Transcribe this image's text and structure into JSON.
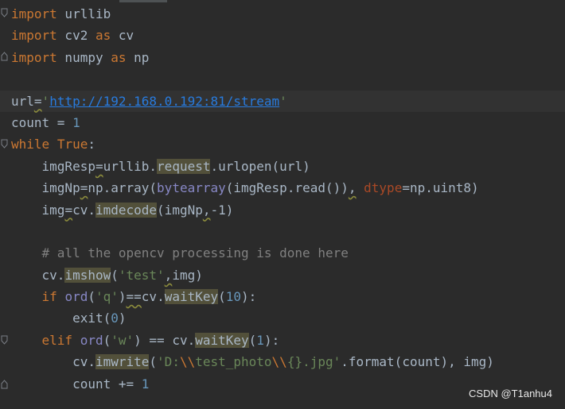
{
  "editor": {
    "lines": [
      {
        "tokens": [
          [
            "kw",
            "import"
          ],
          [
            "",
            "urllib"
          ]
        ]
      },
      {
        "tokens": [
          [
            "kw",
            "import"
          ],
          [
            "",
            "cv2"
          ],
          [
            "kw",
            "as"
          ],
          [
            "",
            "cv"
          ]
        ]
      },
      {
        "tokens": [
          [
            "kw",
            "import"
          ],
          [
            "",
            "numpy"
          ],
          [
            "kw",
            "as"
          ],
          [
            "",
            "np"
          ]
        ]
      },
      {
        "tokens": []
      },
      {
        "current": true,
        "tokens": [
          [
            "",
            "url"
          ],
          [
            "squig",
            "="
          ],
          [
            "str",
            "'"
          ],
          [
            "url",
            "http://192.168.0.192:81/stream"
          ],
          [
            "str",
            "'"
          ]
        ]
      },
      {
        "tokens": [
          [
            "",
            "count = "
          ],
          [
            "num",
            "1"
          ]
        ]
      },
      {
        "tokens": [
          [
            "kw",
            "while"
          ],
          [
            "",
            "SP"
          ],
          [
            "kw",
            "True"
          ],
          [
            "",
            ":"
          ]
        ]
      }
    ],
    "code": {
      "l1_kw": "import",
      "l1_mod": " urllib",
      "l2_kw": "import",
      "l2_mod": " cv2 ",
      "l2_as": "as",
      "l2_alias": " cv",
      "l3_kw": "import",
      "l3_mod": " numpy ",
      "l3_as": "as",
      "l3_alias": " np",
      "l5_a": "url",
      "l5_eq": "=",
      "l5_q1": "'",
      "l5_url": "http://192.168.0.192:81/stream",
      "l5_q2": "'",
      "l6_a": "count = ",
      "l6_num": "1",
      "l7_kw": "while",
      "l7_sp": " ",
      "l7_true": "True",
      "l7_colon": ":",
      "l8_a": "    imgResp",
      "l8_eq": "=",
      "l8_b": "urllib.",
      "l8_req": "request",
      "l8_c": ".urlopen(url)",
      "l9_a": "    imgNp",
      "l9_eq": "=",
      "l9_b": "np.array(",
      "l9_bi": "bytearray",
      "l9_c": "(imgResp.read())",
      "l9_comma": ",",
      "l9_sp": " ",
      "l9_param": "dtype",
      "l9_d": "=np.uint8)",
      "l10_a": "    img",
      "l10_eq": "=",
      "l10_b": "cv.",
      "l10_fn": "imdecode",
      "l10_c": "(imgNp",
      "l10_comma": ",",
      "l10_num": "-1",
      "l10_d": ")",
      "l12_cm": "    # all the opencv processing is done here",
      "l13_a": "    cv.",
      "l13_fn": "imshow",
      "l13_b": "(",
      "l13_str": "'test'",
      "l13_comma": ",",
      "l13_c": "img)",
      "l14_ind": "    ",
      "l14_kw": "if",
      "l14_sp": " ",
      "l14_bi": "ord",
      "l14_b": "(",
      "l14_str": "'q'",
      "l14_c": ")",
      "l14_eq": "==",
      "l14_d": "cv.",
      "l14_fn": "waitKey",
      "l14_e": "(",
      "l14_num": "10",
      "l14_f": "):",
      "l15_a": "        exit(",
      "l15_num": "0",
      "l15_b": ")",
      "l16_ind": "    ",
      "l16_kw": "elif",
      "l16_sp": " ",
      "l16_bi": "ord",
      "l16_b": "(",
      "l16_str": "'w'",
      "l16_c": ") == cv.",
      "l16_fn": "waitKey",
      "l16_d": "(",
      "l16_num": "1",
      "l16_e": "):",
      "l17_a": "        cv.",
      "l17_fn": "imwrite",
      "l17_b": "(",
      "l17_s1": "'D:",
      "l17_e1": "\\\\",
      "l17_s2": "test_photo",
      "l17_e2": "\\\\",
      "l17_s3": "{}.jpg'",
      "l17_c": ".format(count), img)",
      "l18_a": "        count += ",
      "l18_num": "1"
    }
  },
  "watermark": "CSDN @T1anhu4",
  "colors": {
    "background": "#2b2b2b",
    "keyword": "#cc7832",
    "string": "#6a8759",
    "number": "#6897bb",
    "comment": "#808080",
    "url": "#287bde",
    "builtin": "#8888c6",
    "parameter": "#aa4926",
    "usage-highlight": "#52503a"
  }
}
